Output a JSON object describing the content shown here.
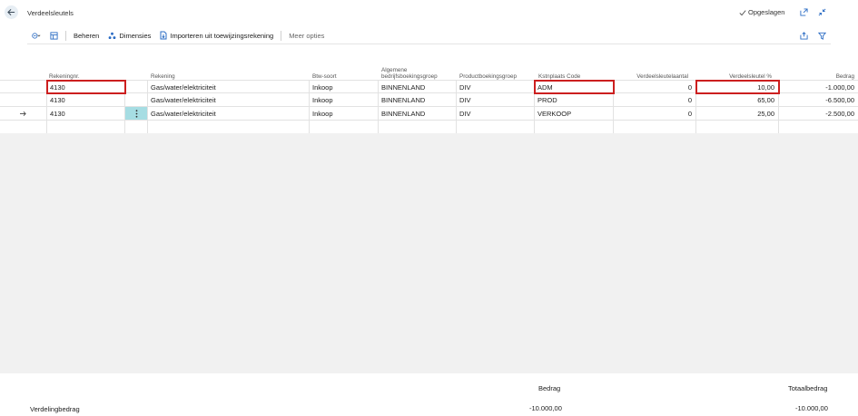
{
  "page": {
    "title": "Verdeelsleutels",
    "saved_label": "Opgeslagen"
  },
  "actions": {
    "manage": "Beheren",
    "dimensions": "Dimensies",
    "import": "Importeren uit toewijzingsrekening",
    "more": "Meer opties"
  },
  "columns": {
    "account_no": "Rekeningnr.",
    "account": "Rekening",
    "vat_type": "Btw-soort",
    "gen_bus_group_1": "Algemene",
    "gen_bus_group_2": "bedrijfsboekingsgroep",
    "gen_prod_group": "Productboekingsgroep",
    "cost_center": "Kstnplaats Code",
    "alloc_qty": "Verdeelsleutelaantal",
    "alloc_pct": "Verdeelsleutel %",
    "amount": "Bedrag"
  },
  "rows": [
    {
      "account_no": "4130",
      "account": "Gas/water/elektriciteit",
      "vat_type": "Inkoop",
      "gen_bus_group": "BINNENLAND",
      "gen_prod_group": "DIV",
      "cost_center": "ADM",
      "alloc_qty": "0",
      "alloc_pct": "10,00",
      "amount": "-1.000,00"
    },
    {
      "account_no": "4130",
      "account": "Gas/water/elektriciteit",
      "vat_type": "Inkoop",
      "gen_bus_group": "BINNENLAND",
      "gen_prod_group": "DIV",
      "cost_center": "PROD",
      "alloc_qty": "0",
      "alloc_pct": "65,00",
      "amount": "-6.500,00"
    },
    {
      "account_no": "4130",
      "account": "Gas/water/elektriciteit",
      "vat_type": "Inkoop",
      "gen_bus_group": "BINNENLAND",
      "gen_prod_group": "DIV",
      "cost_center": "VERKOOP",
      "alloc_qty": "0",
      "alloc_pct": "25,00",
      "amount": "-2.500,00"
    }
  ],
  "footer": {
    "amount_header": "Bedrag",
    "total_header": "Totaalbedrag",
    "label": "Verdelingbedrag",
    "amount": "-10.000,00",
    "total": "-10.000,00"
  },
  "icons": {
    "back": "back-arrow-icon",
    "saved": "check-icon",
    "open_new": "open-in-new-window-icon",
    "collapse": "collapse-icon",
    "share": "share-icon",
    "filter": "filter-icon"
  },
  "colors": {
    "highlight": "#cc1f1f",
    "accent": "#2b6cc4",
    "selected_cell": "#a6dde3"
  }
}
